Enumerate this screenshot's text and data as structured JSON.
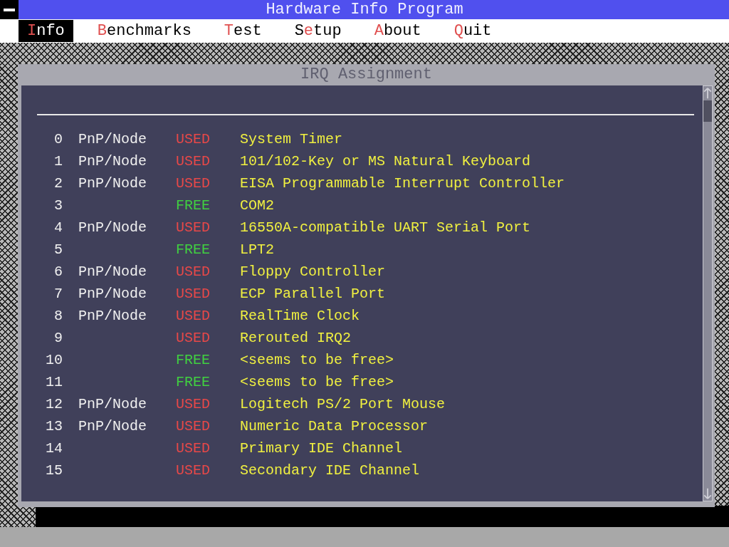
{
  "window": {
    "title": "Hardware Info Program"
  },
  "menu": [
    {
      "key": "I",
      "post": "nfo",
      "selected": true
    },
    {
      "key": "B",
      "post": "enchmarks",
      "selected": false
    },
    {
      "key": "T",
      "post": "est",
      "selected": false
    },
    {
      "pre": "S",
      "key": "e",
      "post": "tup",
      "selected": false
    },
    {
      "key": "A",
      "post": "bout",
      "selected": false
    },
    {
      "key": "Q",
      "post": "uit",
      "selected": false
    }
  ],
  "dialog": {
    "title": "IRQ Assignment",
    "rows": [
      {
        "irq": "0",
        "source": "PnP/Node",
        "status": "USED",
        "free": false,
        "device": "System Timer"
      },
      {
        "irq": "1",
        "source": "PnP/Node",
        "status": "USED",
        "free": false,
        "device": "101/102-Key or MS Natural Keyboard"
      },
      {
        "irq": "2",
        "source": "PnP/Node",
        "status": "USED",
        "free": false,
        "device": "EISA Programmable Interrupt Controller"
      },
      {
        "irq": "3",
        "status": "FREE",
        "free": true,
        "device": "COM2"
      },
      {
        "irq": "4",
        "source": "PnP/Node",
        "status": "USED",
        "free": false,
        "device": "16550A-compatible UART Serial Port"
      },
      {
        "irq": "5",
        "status": "FREE",
        "free": true,
        "device": "LPT2"
      },
      {
        "irq": "6",
        "source": "PnP/Node",
        "status": "USED",
        "free": false,
        "device": "Floppy Controller"
      },
      {
        "irq": "7",
        "source": "PnP/Node",
        "status": "USED",
        "free": false,
        "device": "ECP Parallel Port"
      },
      {
        "irq": "8",
        "source": "PnP/Node",
        "status": "USED",
        "free": false,
        "device": "RealTime Clock"
      },
      {
        "irq": "9",
        "status": "USED",
        "free": false,
        "device": "Rerouted IRQ2"
      },
      {
        "irq": "10",
        "status": "FREE",
        "free": true,
        "device": "<seems to be free>"
      },
      {
        "irq": "11",
        "status": "FREE",
        "free": true,
        "device": "<seems to be free>"
      },
      {
        "irq": "12",
        "source": "PnP/Node",
        "status": "USED",
        "free": false,
        "device": "Logitech PS/2 Port Mouse"
      },
      {
        "irq": "13",
        "source": "PnP/Node",
        "status": "USED",
        "free": false,
        "device": "Numeric Data Processor"
      },
      {
        "irq": "14",
        "status": "USED",
        "free": false,
        "device": "Primary IDE Channel"
      },
      {
        "irq": "15",
        "status": "USED",
        "free": false,
        "device": "Secondary IDE Channel"
      }
    ]
  }
}
